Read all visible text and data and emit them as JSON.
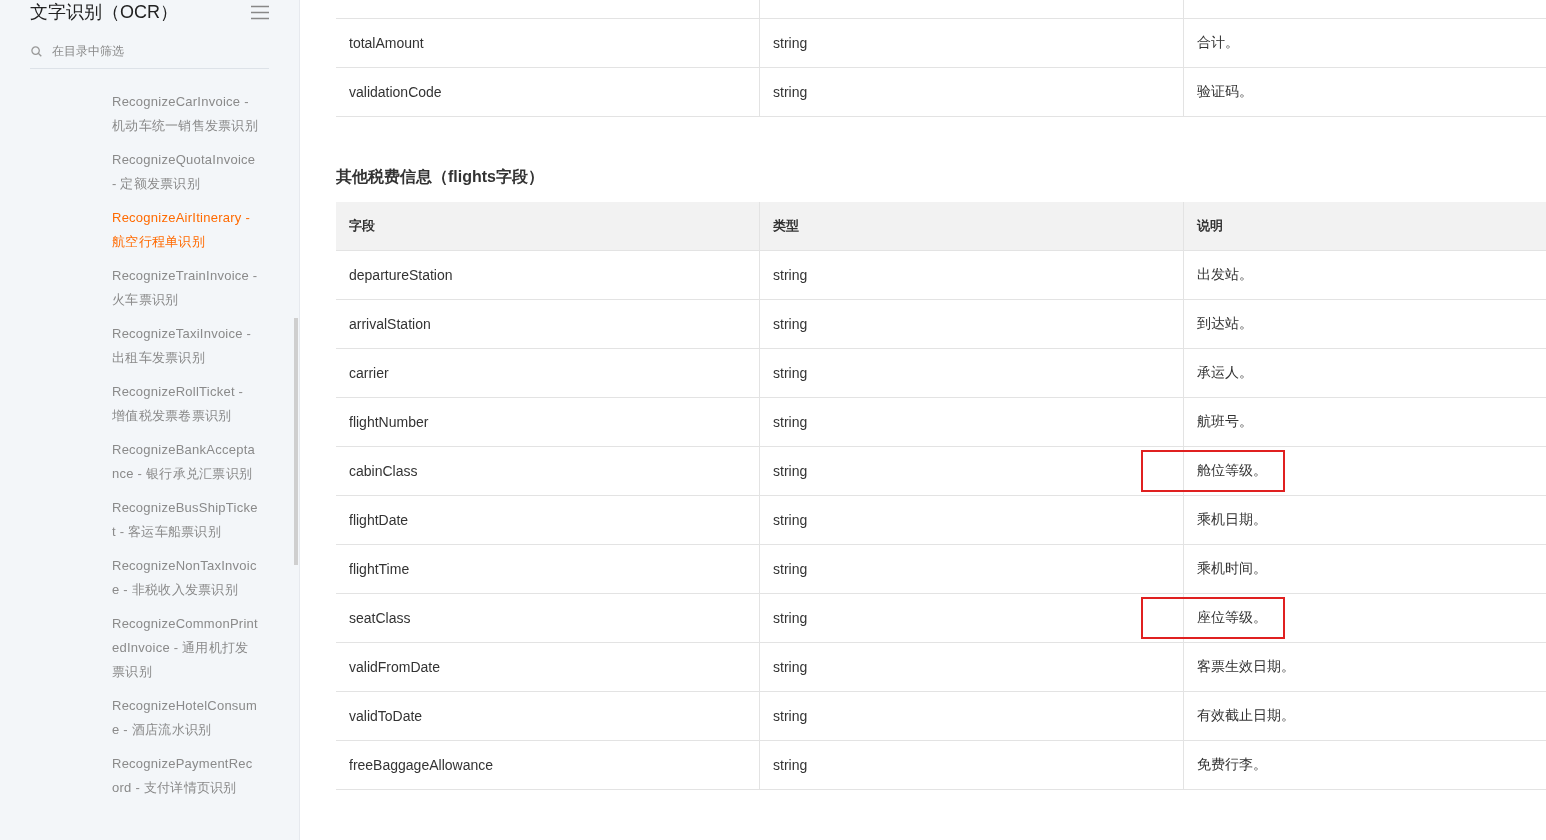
{
  "sidebar": {
    "title": "文字识别（OCR）",
    "search": {
      "placeholder": "在目录中筛选"
    },
    "items": [
      {
        "label": "RecognizeCarInvoice - 机动车统一销售发票识别",
        "selected": false
      },
      {
        "label": "RecognizeQuotaInvoice - 定额发票识别",
        "selected": false
      },
      {
        "label": "RecognizeAirItinerary - 航空行程单识别",
        "selected": true
      },
      {
        "label": "RecognizeTrainInvoice - 火车票识别",
        "selected": false
      },
      {
        "label": "RecognizeTaxiInvoice - 出租车发票识别",
        "selected": false
      },
      {
        "label": "RecognizeRollTicket - 增值税发票卷票识别",
        "selected": false
      },
      {
        "label": "RecognizeBankAcceptance - 银行承兑汇票识别",
        "selected": false
      },
      {
        "label": "RecognizeBusShipTicket - 客运车船票识别",
        "selected": false
      },
      {
        "label": "RecognizeNonTaxInvoice - 非税收入发票识别",
        "selected": false
      },
      {
        "label": "RecognizeCommonPrintedInvoice - 通用机打发票识别",
        "selected": false
      },
      {
        "label": "RecognizeHotelConsume - 酒店流水识别",
        "selected": false
      },
      {
        "label": "RecognizePaymentRecord - 支付详情页识别",
        "selected": false
      }
    ]
  },
  "top_table": {
    "rows": [
      {
        "field": "totalAmount",
        "type": "string",
        "description": "合计。"
      },
      {
        "field": "validationCode",
        "type": "string",
        "description": "验证码。"
      }
    ]
  },
  "section_heading": "其他税费信息（flights字段）",
  "flights_table": {
    "columns": [
      "字段",
      "类型",
      "说明"
    ],
    "rows": [
      {
        "field": "departureStation",
        "type": "string",
        "description": "出发站。",
        "highlighted": false
      },
      {
        "field": "arrivalStation",
        "type": "string",
        "description": "到达站。",
        "highlighted": false
      },
      {
        "field": "carrier",
        "type": "string",
        "description": "承运人。",
        "highlighted": false
      },
      {
        "field": "flightNumber",
        "type": "string",
        "description": "航班号。",
        "highlighted": false
      },
      {
        "field": "cabinClass",
        "type": "string",
        "description": "舱位等级。",
        "highlighted": true
      },
      {
        "field": "flightDate",
        "type": "string",
        "description": "乘机日期。",
        "highlighted": false
      },
      {
        "field": "flightTime",
        "type": "string",
        "description": "乘机时间。",
        "highlighted": false
      },
      {
        "field": "seatClass",
        "type": "string",
        "description": "座位等级。",
        "highlighted": true
      },
      {
        "field": "validFromDate",
        "type": "string",
        "description": "客票生效日期。",
        "highlighted": false
      },
      {
        "field": "validToDate",
        "type": "string",
        "description": "有效截止日期。",
        "highlighted": false
      },
      {
        "field": "freeBaggageAllowance",
        "type": "string",
        "description": "免费行李。",
        "highlighted": false
      }
    ]
  }
}
